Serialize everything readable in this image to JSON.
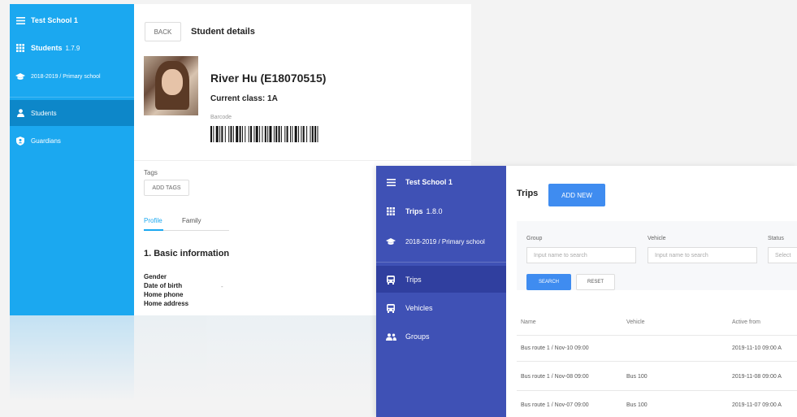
{
  "student_app": {
    "sidebar": {
      "school": "Test School 1",
      "app_name": "Students",
      "version": "1.7.9",
      "term": "2018-2019 / Primary school",
      "items": [
        {
          "label": "Students",
          "icon": "person-icon",
          "selected": true
        },
        {
          "label": "Guardians",
          "icon": "shield-person-icon",
          "selected": false
        }
      ]
    },
    "header": {
      "back_label": "BACK",
      "title": "Student details"
    },
    "student": {
      "name": "River Hu (E18070515)",
      "current_class": "Current class: 1A",
      "barcode_label": "Barcode"
    },
    "tags": {
      "label": "Tags",
      "add_label": "ADD TAGS"
    },
    "tabs": [
      "Profile",
      "Family"
    ],
    "section_title": "1. Basic information",
    "fields": [
      "Gender",
      "Date of birth",
      "Home phone",
      "Home address"
    ],
    "dob_value": "-",
    "accent_color": "#1ba8f0"
  },
  "trips_app": {
    "sidebar": {
      "school": "Test School 1",
      "app_name": "Trips",
      "version": "1.8.0",
      "term": "2018-2019 / Primary school",
      "items": [
        {
          "label": "Trips",
          "icon": "bus-icon",
          "selected": true
        },
        {
          "label": "Vehicles",
          "icon": "bus-icon",
          "selected": false
        },
        {
          "label": "Groups",
          "icon": "group-icon",
          "selected": false
        }
      ]
    },
    "header": {
      "title": "Trips",
      "add_label": "ADD NEW"
    },
    "filters": {
      "group_label": "Group",
      "group_placeholder": "Input name to search",
      "vehicle_label": "Vehicle",
      "vehicle_placeholder": "Input name to search",
      "status_label": "Status",
      "status_placeholder": "Select",
      "search_label": "SEARCH",
      "reset_label": "RESET"
    },
    "table": {
      "columns": [
        "Name",
        "Vehicle",
        "Active from"
      ],
      "rows": [
        [
          "Bus route 1 / Nov-10 09:00",
          "",
          "2019-11-10 09:00 A"
        ],
        [
          "Bus route 1 / Nov-08 09:00",
          "Bus 100",
          "2019-11-08 09:00 A"
        ],
        [
          "Bus route 1 / Nov-07 09:00",
          "Bus 100",
          "2019-11-07 09:00 A"
        ]
      ]
    },
    "accent_color": "#3f51b5"
  }
}
